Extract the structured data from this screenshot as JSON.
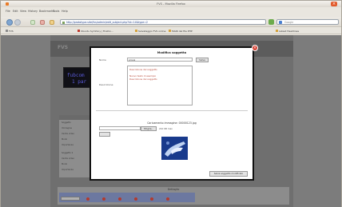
{
  "window": {
    "title": "FVS - Mozilla Firefox"
  },
  "menu": [
    "File",
    "Edit",
    "View",
    "History",
    "Bookmarks",
    "Tools",
    "Help"
  ],
  "nav": {
    "url": "http://prototype.site/fvs/admin/edit_subject.php?id=14&type=2",
    "search_placeholder": "Google"
  },
  "bookmarks": [
    {
      "label": "FVS"
    },
    {
      "label": "Ubuntu Symfony | Firefox..."
    },
    {
      "label": "Salvataggio FVS online"
    },
    {
      "label": "MAIN del file PHP"
    },
    {
      "label": "Latest Headlines"
    }
  ],
  "page": {
    "logo": "FVS",
    "banner_line1": "fubcom",
    "banner_line2": "1 par",
    "left_panel_rows": [
      "Soggetto",
      "Immagine",
      "Uscita video",
      "Modo",
      "Importanza",
      "Soggetto 2",
      "Uscita video",
      "Modo",
      "Importanza"
    ],
    "bottom_title": "Dettaglio",
    "bottom_select": "Tutti i soggetti"
  },
  "modal": {
    "title": "Modifica soggetto",
    "name_label": "Nome",
    "name_value": "prova",
    "name_button": "Salva",
    "description_label": "Descrizione",
    "description_lines": [
      "Descrizione del soggetto",
      "",
      "Nuovo testo di esempio",
      "Descrizione del soggetto"
    ],
    "upload_title": "Caricamento immagine: 00000123.jpg",
    "browse_button": "Sfoglia...",
    "size_text": "210 KB max",
    "submit_button": "Salva soggetto modificato"
  },
  "colors": {
    "overlay": "#7c7c7c",
    "modal_close": "#d43a2c",
    "thumbnail": "#1a3b8f"
  }
}
